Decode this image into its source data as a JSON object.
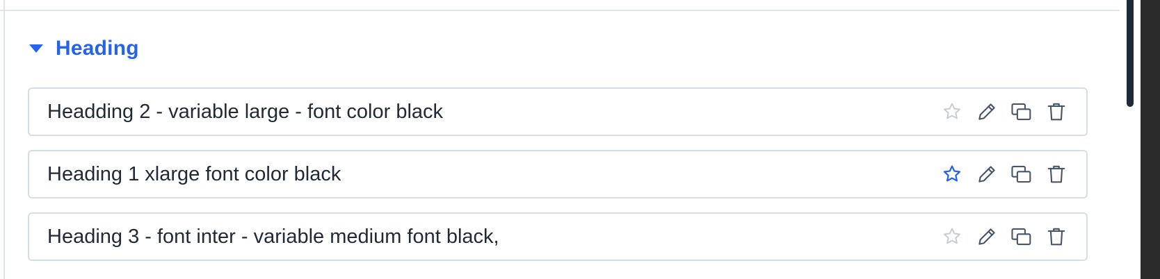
{
  "section": {
    "title": "Heading",
    "expanded": true,
    "caret_icon": "caret-down-icon",
    "accent_color": "#2563eb"
  },
  "items": [
    {
      "label": "Headding 2 - variable large - font color black",
      "favorite": false
    },
    {
      "label": "Heading 1 xlarge font color black",
      "favorite": true
    },
    {
      "label": "Heading 3 - font inter - variable medium font black,",
      "favorite": false
    }
  ],
  "item_actions": [
    "star-icon",
    "pencil-icon",
    "duplicate-icon",
    "trash-icon"
  ],
  "colors": {
    "text": "#1f2937",
    "icon": "#475569",
    "star_inactive": "#c7ccd8",
    "star_active": "#2563eb",
    "border": "#d8dce8"
  }
}
